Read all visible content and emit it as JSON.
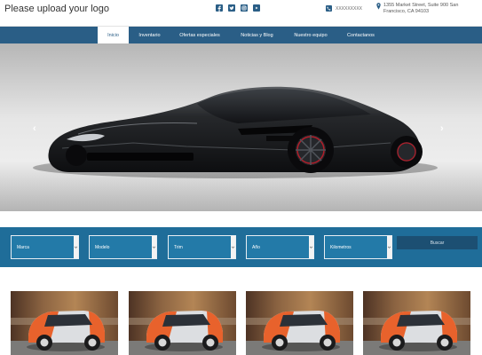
{
  "header": {
    "logo_text": "Please upload your logo",
    "social_icons": [
      "facebook-icon",
      "twitter-icon",
      "instagram-icon",
      "youtube-icon"
    ],
    "phone": "XXXXXXXXX",
    "address": "1355 Market Street, Suite 900 San Francisco, CA 94103"
  },
  "nav": {
    "items": [
      {
        "label": "Inicio",
        "active": true
      },
      {
        "label": "Inventario",
        "active": false
      },
      {
        "label": "Ofertas especiales",
        "active": false
      },
      {
        "label": "Noticias y Blog",
        "active": false
      },
      {
        "label": "Nuestro equipo",
        "active": false
      },
      {
        "label": "Contactanos",
        "active": false
      }
    ]
  },
  "hero": {
    "prev_label": "‹",
    "next_label": "›",
    "slide_count": 4,
    "active_slide": 1,
    "active_dot_color": "#f1c40f"
  },
  "search": {
    "fields": [
      {
        "label": "Marca"
      },
      {
        "label": "Modelo"
      },
      {
        "label": "Trim"
      },
      {
        "label": "Año"
      },
      {
        "label": "Kilometros"
      }
    ],
    "button_label": "Buscar"
  },
  "listings": {
    "count": 4
  },
  "colors": {
    "nav_bg": "#2a5e86",
    "search_bg": "#1f6d99",
    "accent_orange": "#e8622c"
  }
}
